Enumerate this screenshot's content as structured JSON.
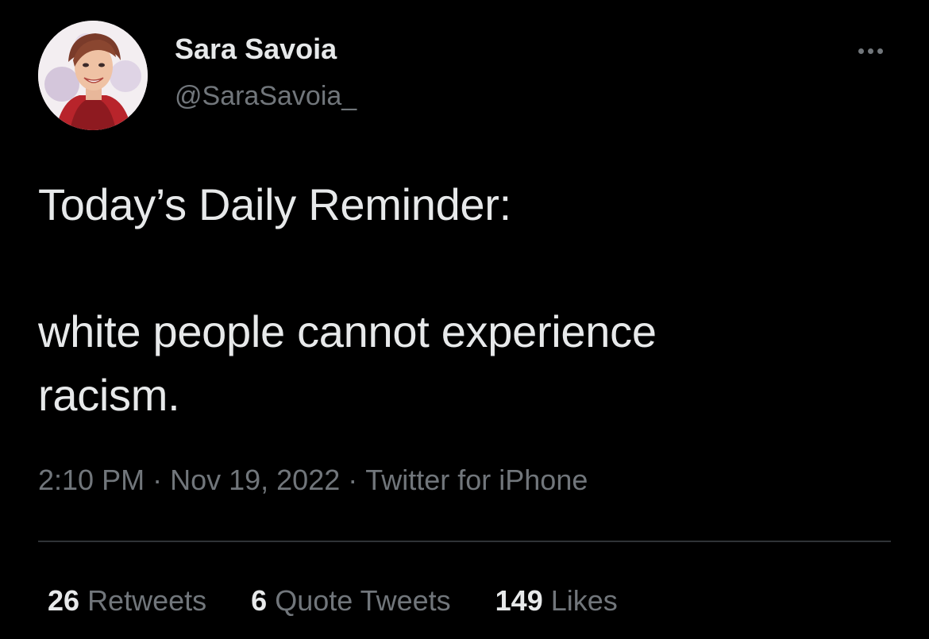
{
  "author": {
    "display_name": "Sara Savoia",
    "handle": "@SaraSavoia_",
    "avatar_icon": "user-avatar-illustration"
  },
  "tweet": {
    "lines": [
      "Today’s Daily Reminder:",
      "",
      "white people cannot experience",
      "racism."
    ],
    "time": "2:10 PM",
    "date": "Nov 19, 2022",
    "source": "Twitter for iPhone",
    "separator": "·"
  },
  "stats": {
    "retweets_count": "26",
    "retweets_label": "Retweets",
    "quotes_count": "6",
    "quotes_label": "Quote Tweets",
    "likes_count": "149",
    "likes_label": "Likes"
  },
  "theme": {
    "background": "#000000",
    "primary_text": "#e7e9ea",
    "secondary_text": "#71767b",
    "divider": "#2f3336"
  },
  "icons": {
    "more": "more-horizontal-icon"
  }
}
